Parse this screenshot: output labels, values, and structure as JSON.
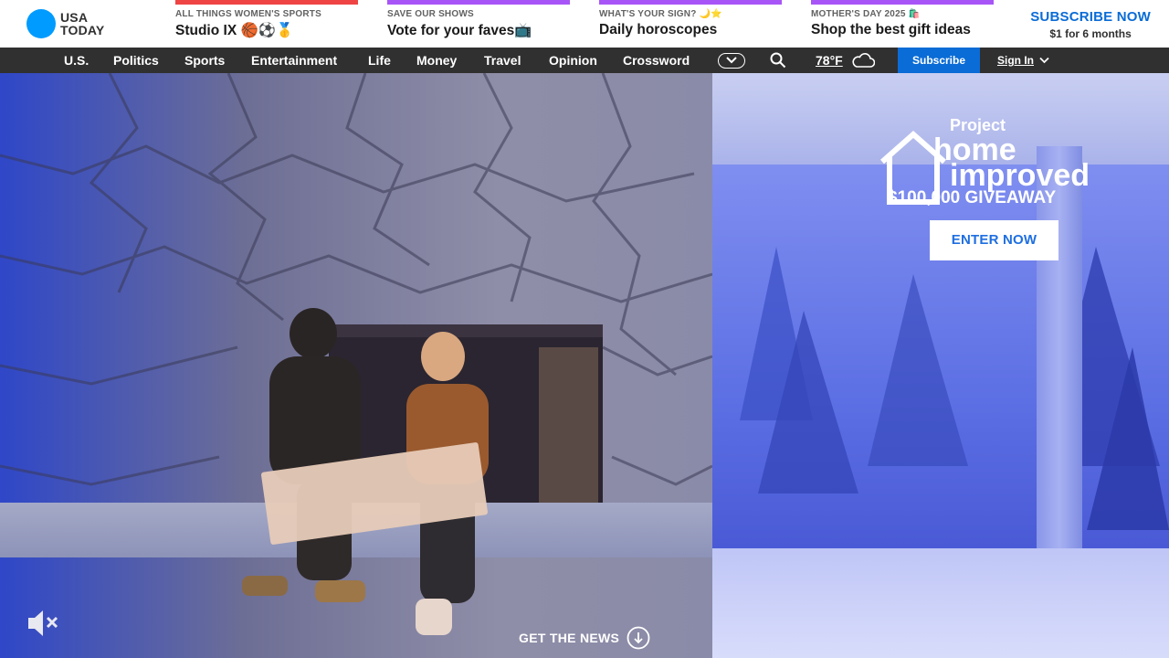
{
  "brand": {
    "logo_line1": "USA",
    "logo_line2": "TODAY"
  },
  "promos": [
    {
      "kicker": "ALL THINGS WOMEN'S SPORTS",
      "title": "Studio IX 🏀⚽🥇",
      "color": "#ef4444"
    },
    {
      "kicker": "SAVE OUR SHOWS",
      "title": "Vote for your faves📺",
      "color": "#a855f7"
    },
    {
      "kicker": "WHAT'S YOUR SIGN? 🌙⭐",
      "title": "Daily horoscopes",
      "color": "#a855f7"
    },
    {
      "kicker": "MOTHER'S DAY 2025 🛍️",
      "title": "Shop the best gift ideas",
      "color": "#a855f7"
    }
  ],
  "subscribe_cta": {
    "headline": "SUBSCRIBE NOW",
    "subline": "$1 for 6 months"
  },
  "nav": {
    "items": [
      "U.S.",
      "Politics",
      "Sports",
      "Entertainment",
      "Life",
      "Money",
      "Travel",
      "Opinion",
      "Crossword"
    ],
    "weather_temp": "78°F",
    "subscribe_label": "Subscribe",
    "signin_label": "Sign In"
  },
  "hero": {
    "campaign_small": "Project",
    "campaign_big1": "home",
    "campaign_big2": "improved",
    "giveaway": "$100,000 GIVEAWAY",
    "cta_label": "ENTER NOW",
    "get_news_label": "GET THE NEWS"
  },
  "icons": {
    "more": "chevron-down-icon",
    "search": "search-icon",
    "weather": "cloud-icon",
    "mute": "speaker-muted-icon",
    "down": "arrow-down-circle-icon"
  },
  "colors": {
    "accent": "#0a6cd6",
    "nav_bg": "#303030",
    "logo_dot": "#009bff"
  }
}
